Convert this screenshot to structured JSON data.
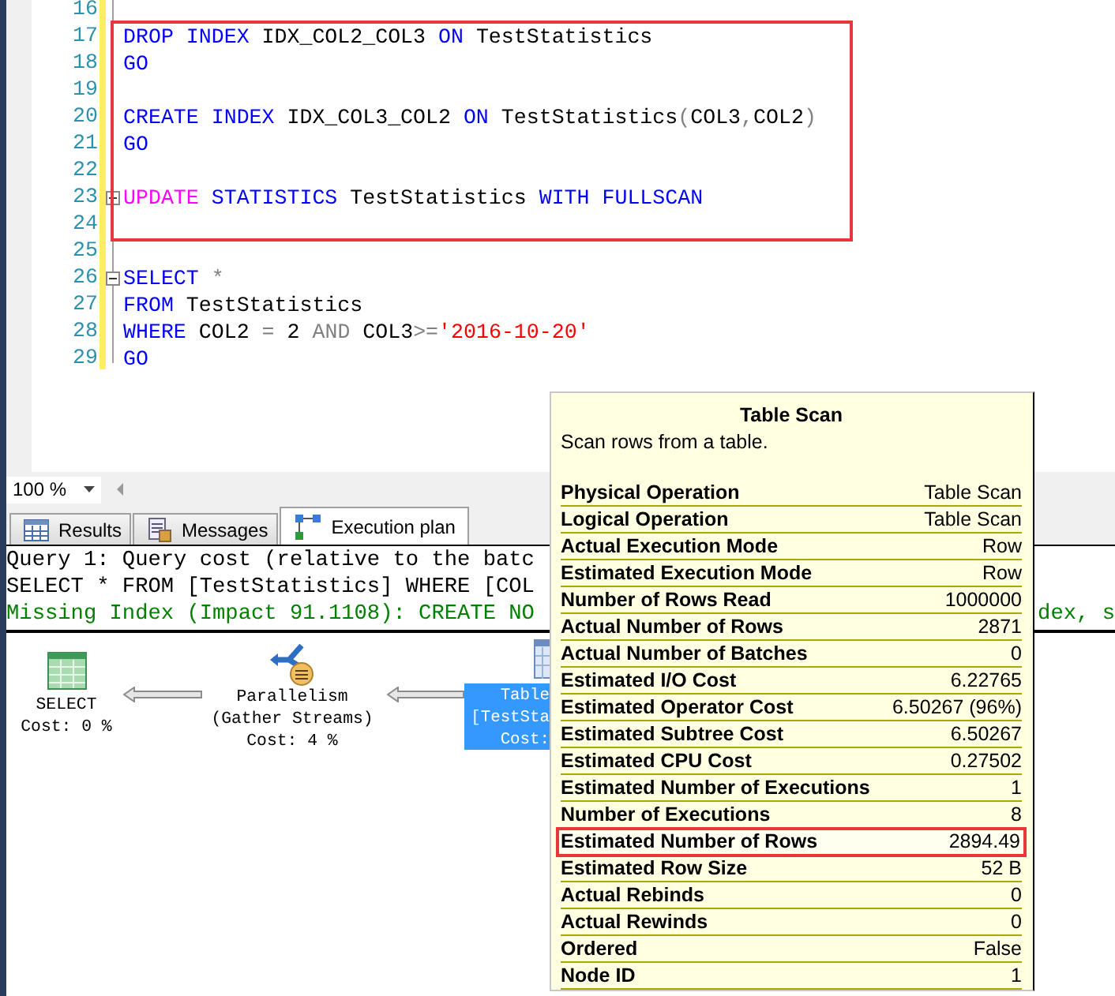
{
  "editor": {
    "blocks": [
      {
        "kind": "plain",
        "lines": [
          {
            "number": "16",
            "fold": false
          }
        ]
      },
      {
        "kind": "callout",
        "lines": [
          {
            "number": "17",
            "fold": false,
            "tokens": [
              {
                "kind": "kw",
                "t": "DROP INDEX "
              },
              {
                "kind": "id",
                "t": "IDX_COL2_COL3 "
              },
              {
                "kind": "kw",
                "t": "ON "
              },
              {
                "kind": "id",
                "t": "TestStatistics"
              }
            ]
          },
          {
            "number": "18",
            "fold": false,
            "tokens": [
              {
                "kind": "kw",
                "t": "GO"
              }
            ]
          },
          {
            "number": "19",
            "fold": false
          },
          {
            "number": "20",
            "fold": false,
            "tokens": [
              {
                "kind": "kw",
                "t": "CREATE INDEX "
              },
              {
                "kind": "id",
                "t": "IDX_COL3_COL2 "
              },
              {
                "kind": "kw",
                "t": "ON "
              },
              {
                "kind": "id",
                "t": "TestStatistics"
              },
              {
                "kind": "op",
                "t": "("
              },
              {
                "kind": "id",
                "t": "COL3"
              },
              {
                "kind": "op",
                "t": ","
              },
              {
                "kind": "id",
                "t": "COL2"
              },
              {
                "kind": "op",
                "t": ")"
              }
            ]
          },
          {
            "number": "21",
            "fold": false,
            "tokens": [
              {
                "kind": "kw",
                "t": "GO"
              }
            ]
          },
          {
            "number": "22",
            "fold": false
          },
          {
            "number": "23",
            "fold": true,
            "tokens": [
              {
                "kind": "fn",
                "t": "UPDATE "
              },
              {
                "kind": "kw",
                "t": "STATISTICS "
              },
              {
                "kind": "id",
                "t": "TestStatistics "
              },
              {
                "kind": "kw",
                "t": "WITH FULLSCAN"
              }
            ]
          },
          {
            "number": "24",
            "fold": false
          }
        ]
      },
      {
        "kind": "plain",
        "lines": [
          {
            "number": "25",
            "fold": false
          },
          {
            "number": "26",
            "fold": true,
            "tokens": [
              {
                "kind": "kw",
                "t": "SELECT "
              },
              {
                "kind": "op",
                "t": "*"
              }
            ]
          },
          {
            "number": "27",
            "fold": false,
            "tokens": [
              {
                "kind": "kw",
                "t": "FROM "
              },
              {
                "kind": "id",
                "t": "TestStatistics"
              }
            ]
          },
          {
            "number": "28",
            "fold": false,
            "tokens": [
              {
                "kind": "kw",
                "t": "WHERE "
              },
              {
                "kind": "id",
                "t": "COL2 "
              },
              {
                "kind": "op",
                "t": "= "
              },
              {
                "kind": "id",
                "t": "2 "
              },
              {
                "kind": "op",
                "t": "AND "
              },
              {
                "kind": "id",
                "t": "COL3"
              },
              {
                "kind": "op",
                "t": ">="
              },
              {
                "kind": "str",
                "t": "'2016-10-20'"
              }
            ]
          },
          {
            "number": "29",
            "fold": false,
            "tokens": [
              {
                "kind": "kw",
                "t": "GO"
              }
            ]
          }
        ]
      }
    ]
  },
  "zoom": {
    "value": "100 %"
  },
  "tabs": [
    {
      "label": "Results",
      "kind": "results",
      "selected": false
    },
    {
      "label": "Messages",
      "kind": "messages",
      "selected": false
    },
    {
      "label": "Execution plan",
      "kind": "plan",
      "selected": true
    }
  ],
  "query_lines": [
    {
      "text": "Query 1: Query cost (relative to the batc",
      "kind": "plain"
    },
    {
      "text": "SELECT * FROM [TestStatistics] WHERE [COL",
      "kind": "plain"
    },
    {
      "text": "Missing Index (Impact 91.1108): CREATE NO",
      "kind": "missing_index",
      "tail": "dex, s"
    }
  ],
  "plan_nodes": [
    {
      "kind": "select",
      "selected": false,
      "lines": [
        "SELECT",
        "Cost: 0 %"
      ]
    },
    {
      "kind": "parallelism",
      "selected": false,
      "lines": [
        "Parallelism",
        "(Gather Streams)",
        "Cost: 4 %"
      ]
    },
    {
      "kind": "table_scan",
      "selected": true,
      "lines": [
        "Table",
        "[TestSta",
        "Cost:"
      ]
    }
  ],
  "tooltip": {
    "title": "Table Scan",
    "description": "Scan rows from a table.",
    "rows": [
      {
        "label": "Physical Operation",
        "value": "Table Scan",
        "highlighted": false
      },
      {
        "label": "Logical Operation",
        "value": "Table Scan",
        "highlighted": false
      },
      {
        "label": "Actual Execution Mode",
        "value": "Row",
        "highlighted": false
      },
      {
        "label": "Estimated Execution Mode",
        "value": "Row",
        "highlighted": false
      },
      {
        "label": "Number of Rows Read",
        "value": "1000000",
        "highlighted": false
      },
      {
        "label": "Actual Number of Rows",
        "value": "2871",
        "highlighted": false
      },
      {
        "label": "Actual Number of Batches",
        "value": "0",
        "highlighted": false
      },
      {
        "label": "Estimated I/O Cost",
        "value": "6.22765",
        "highlighted": false
      },
      {
        "label": "Estimated Operator Cost",
        "value": "6.50267 (96%)",
        "highlighted": false
      },
      {
        "label": "Estimated Subtree Cost",
        "value": "6.50267",
        "highlighted": false
      },
      {
        "label": "Estimated CPU Cost",
        "value": "0.27502",
        "highlighted": false
      },
      {
        "label": "Estimated Number of Executions",
        "value": "1",
        "highlighted": false
      },
      {
        "label": "Number of Executions",
        "value": "8",
        "highlighted": false
      },
      {
        "label": "Estimated Number of Rows",
        "value": "2894.49",
        "highlighted": true
      },
      {
        "label": "Estimated Row Size",
        "value": "52 B",
        "highlighted": false
      },
      {
        "label": "Actual Rebinds",
        "value": "0",
        "highlighted": false
      },
      {
        "label": "Actual Rewinds",
        "value": "0",
        "highlighted": false
      },
      {
        "label": "Ordered",
        "value": "False",
        "highlighted": false
      },
      {
        "label": "Node ID",
        "value": "1",
        "highlighted": false
      }
    ]
  }
}
